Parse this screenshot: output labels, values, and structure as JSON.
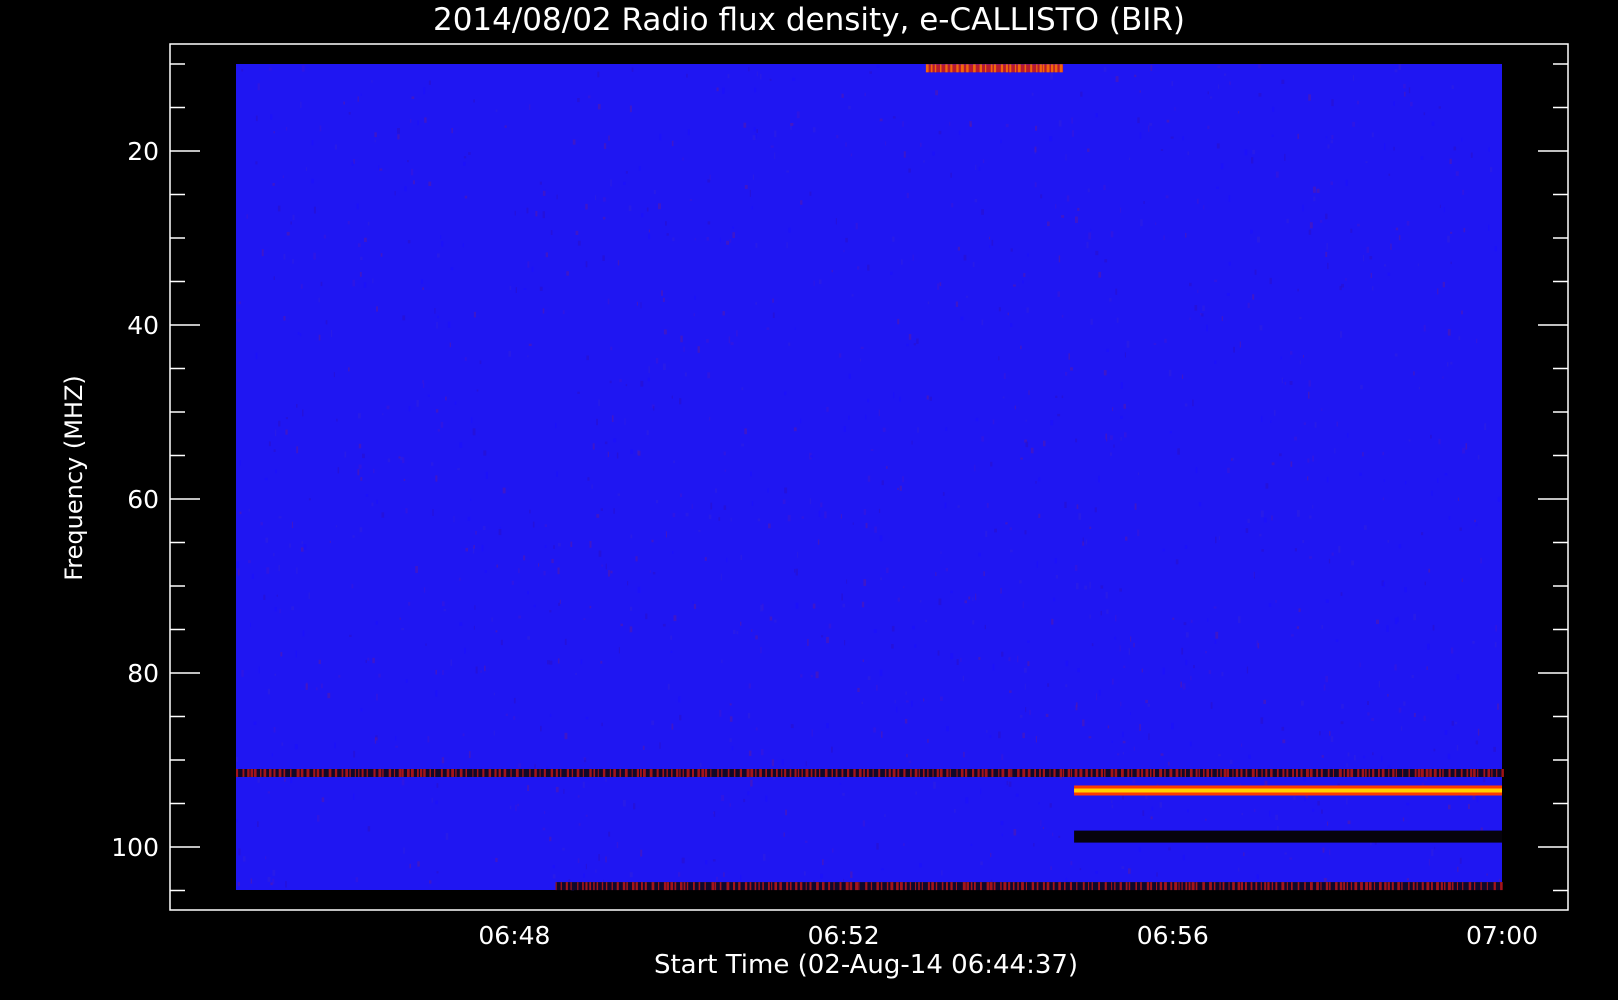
{
  "chart_data": {
    "type": "heatmap",
    "title": "2014/08/02  Radio flux density, e-CALLISTO (BIR)",
    "xlabel": "Start Time (02-Aug-14 06:44:37)",
    "ylabel": "Frequency (MHZ)",
    "x_start": "06:44:37",
    "x_end": "07:00:00",
    "xlim_minutes_after_0644": [
      0.62,
      16.0
    ],
    "ylim_mhz": [
      10,
      106
    ],
    "y_axis_inverted": true,
    "x_major_ticks": [
      "06:48",
      "06:52",
      "06:56",
      "07:00"
    ],
    "y_major_ticks": [
      20,
      40,
      60,
      80,
      100
    ],
    "colormap": [
      "#000000",
      "#0000ff",
      "#ff0000",
      "#ffff00"
    ],
    "background_level": "blue",
    "features": [
      {
        "frequency_mhz": 91.5,
        "time_start": "06:44:37",
        "time_end": "07:00:00",
        "level": "dark/red striped"
      },
      {
        "frequency_mhz": 93.5,
        "time_start": "06:54:48",
        "time_end": "07:00:00",
        "level": "bright yellow-red"
      },
      {
        "frequency_mhz": 98.8,
        "time_start": "06:54:48",
        "time_end": "07:00:00",
        "level": "dark"
      },
      {
        "frequency_mhz": 104.5,
        "time_start": "06:48:30",
        "time_end": "07:00:00",
        "level": "dark/red striped"
      },
      {
        "frequency_mhz": 10.5,
        "time_start": "06:53:00",
        "time_end": "06:54:40",
        "level": "red/yellow"
      }
    ]
  }
}
